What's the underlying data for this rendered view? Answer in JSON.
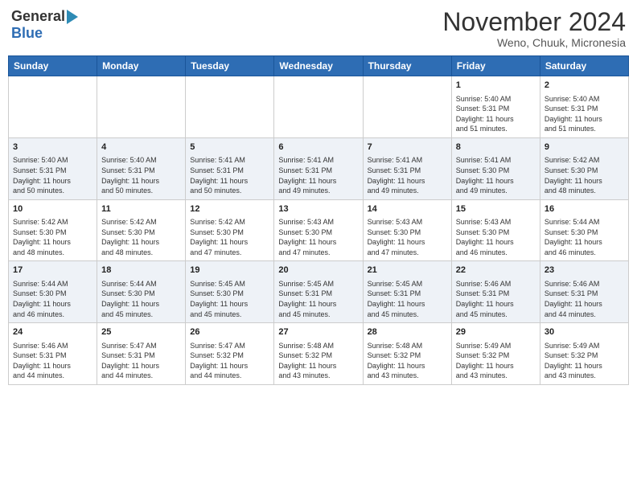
{
  "header": {
    "logo_general": "General",
    "logo_blue": "Blue",
    "month_title": "November 2024",
    "location": "Weno, Chuuk, Micronesia"
  },
  "days_of_week": [
    "Sunday",
    "Monday",
    "Tuesday",
    "Wednesday",
    "Thursday",
    "Friday",
    "Saturday"
  ],
  "weeks": [
    [
      {
        "day": "",
        "info": ""
      },
      {
        "day": "",
        "info": ""
      },
      {
        "day": "",
        "info": ""
      },
      {
        "day": "",
        "info": ""
      },
      {
        "day": "",
        "info": ""
      },
      {
        "day": "1",
        "info": "Sunrise: 5:40 AM\nSunset: 5:31 PM\nDaylight: 11 hours\nand 51 minutes."
      },
      {
        "day": "2",
        "info": "Sunrise: 5:40 AM\nSunset: 5:31 PM\nDaylight: 11 hours\nand 51 minutes."
      }
    ],
    [
      {
        "day": "3",
        "info": "Sunrise: 5:40 AM\nSunset: 5:31 PM\nDaylight: 11 hours\nand 50 minutes."
      },
      {
        "day": "4",
        "info": "Sunrise: 5:40 AM\nSunset: 5:31 PM\nDaylight: 11 hours\nand 50 minutes."
      },
      {
        "day": "5",
        "info": "Sunrise: 5:41 AM\nSunset: 5:31 PM\nDaylight: 11 hours\nand 50 minutes."
      },
      {
        "day": "6",
        "info": "Sunrise: 5:41 AM\nSunset: 5:31 PM\nDaylight: 11 hours\nand 49 minutes."
      },
      {
        "day": "7",
        "info": "Sunrise: 5:41 AM\nSunset: 5:31 PM\nDaylight: 11 hours\nand 49 minutes."
      },
      {
        "day": "8",
        "info": "Sunrise: 5:41 AM\nSunset: 5:30 PM\nDaylight: 11 hours\nand 49 minutes."
      },
      {
        "day": "9",
        "info": "Sunrise: 5:42 AM\nSunset: 5:30 PM\nDaylight: 11 hours\nand 48 minutes."
      }
    ],
    [
      {
        "day": "10",
        "info": "Sunrise: 5:42 AM\nSunset: 5:30 PM\nDaylight: 11 hours\nand 48 minutes."
      },
      {
        "day": "11",
        "info": "Sunrise: 5:42 AM\nSunset: 5:30 PM\nDaylight: 11 hours\nand 48 minutes."
      },
      {
        "day": "12",
        "info": "Sunrise: 5:42 AM\nSunset: 5:30 PM\nDaylight: 11 hours\nand 47 minutes."
      },
      {
        "day": "13",
        "info": "Sunrise: 5:43 AM\nSunset: 5:30 PM\nDaylight: 11 hours\nand 47 minutes."
      },
      {
        "day": "14",
        "info": "Sunrise: 5:43 AM\nSunset: 5:30 PM\nDaylight: 11 hours\nand 47 minutes."
      },
      {
        "day": "15",
        "info": "Sunrise: 5:43 AM\nSunset: 5:30 PM\nDaylight: 11 hours\nand 46 minutes."
      },
      {
        "day": "16",
        "info": "Sunrise: 5:44 AM\nSunset: 5:30 PM\nDaylight: 11 hours\nand 46 minutes."
      }
    ],
    [
      {
        "day": "17",
        "info": "Sunrise: 5:44 AM\nSunset: 5:30 PM\nDaylight: 11 hours\nand 46 minutes."
      },
      {
        "day": "18",
        "info": "Sunrise: 5:44 AM\nSunset: 5:30 PM\nDaylight: 11 hours\nand 45 minutes."
      },
      {
        "day": "19",
        "info": "Sunrise: 5:45 AM\nSunset: 5:30 PM\nDaylight: 11 hours\nand 45 minutes."
      },
      {
        "day": "20",
        "info": "Sunrise: 5:45 AM\nSunset: 5:31 PM\nDaylight: 11 hours\nand 45 minutes."
      },
      {
        "day": "21",
        "info": "Sunrise: 5:45 AM\nSunset: 5:31 PM\nDaylight: 11 hours\nand 45 minutes."
      },
      {
        "day": "22",
        "info": "Sunrise: 5:46 AM\nSunset: 5:31 PM\nDaylight: 11 hours\nand 45 minutes."
      },
      {
        "day": "23",
        "info": "Sunrise: 5:46 AM\nSunset: 5:31 PM\nDaylight: 11 hours\nand 44 minutes."
      }
    ],
    [
      {
        "day": "24",
        "info": "Sunrise: 5:46 AM\nSunset: 5:31 PM\nDaylight: 11 hours\nand 44 minutes."
      },
      {
        "day": "25",
        "info": "Sunrise: 5:47 AM\nSunset: 5:31 PM\nDaylight: 11 hours\nand 44 minutes."
      },
      {
        "day": "26",
        "info": "Sunrise: 5:47 AM\nSunset: 5:32 PM\nDaylight: 11 hours\nand 44 minutes."
      },
      {
        "day": "27",
        "info": "Sunrise: 5:48 AM\nSunset: 5:32 PM\nDaylight: 11 hours\nand 43 minutes."
      },
      {
        "day": "28",
        "info": "Sunrise: 5:48 AM\nSunset: 5:32 PM\nDaylight: 11 hours\nand 43 minutes."
      },
      {
        "day": "29",
        "info": "Sunrise: 5:49 AM\nSunset: 5:32 PM\nDaylight: 11 hours\nand 43 minutes."
      },
      {
        "day": "30",
        "info": "Sunrise: 5:49 AM\nSunset: 5:32 PM\nDaylight: 11 hours\nand 43 minutes."
      }
    ]
  ]
}
